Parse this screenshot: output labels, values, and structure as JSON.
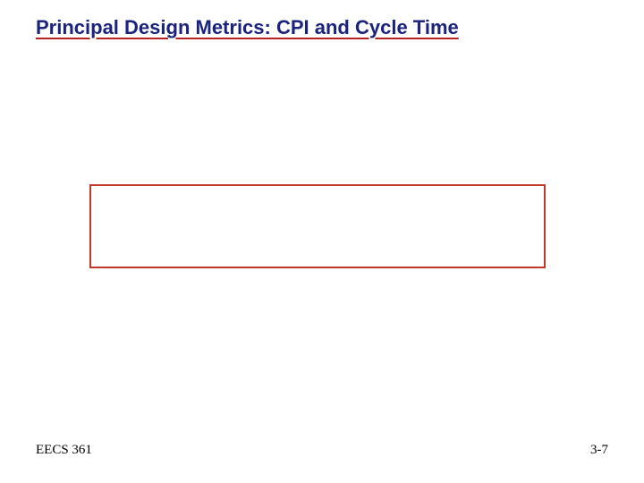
{
  "slide": {
    "title": "Principal Design Metrics: CPI and Cycle Time",
    "footer_left": "EECS 361",
    "footer_right": "3-7"
  }
}
